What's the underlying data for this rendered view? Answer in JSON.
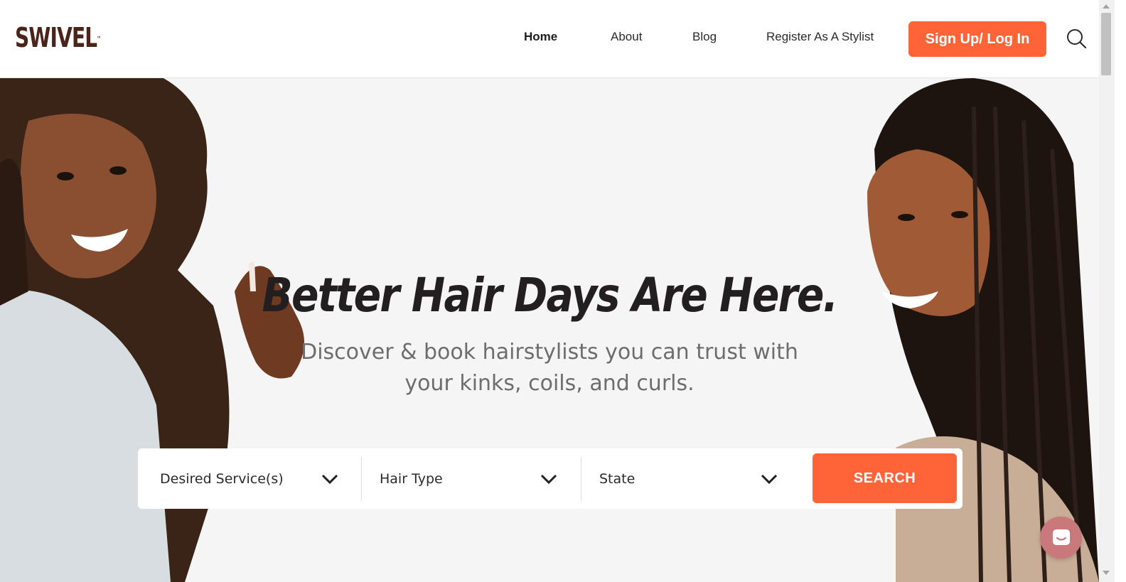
{
  "brand": {
    "logo_text": "SWIVEL",
    "trademark": "™"
  },
  "nav": {
    "items": [
      {
        "label": "Home",
        "active": true
      },
      {
        "label": "About",
        "active": false
      },
      {
        "label": "Blog",
        "active": false
      },
      {
        "label": "Register As A Stylist",
        "active": false
      }
    ],
    "cta_label": "Sign Up/ Log In",
    "search_icon": "search-icon"
  },
  "hero": {
    "headline": "Better Hair Days Are Here.",
    "subhead": "Discover & book hairstylists you can trust with your kinks, coils, and curls."
  },
  "search": {
    "fields": [
      {
        "label": "Desired Service(s)",
        "icon": "chevron-down-icon"
      },
      {
        "label": "Hair Type",
        "icon": "chevron-down-icon"
      },
      {
        "label": "State",
        "icon": "chevron-down-icon"
      }
    ],
    "button_label": "SEARCH"
  },
  "chat": {
    "icon": "chat-icon"
  },
  "colors": {
    "accent": "#ff6338",
    "brand": "#4a2418",
    "chat": "#c9787b",
    "background": "#f5f5f5"
  }
}
